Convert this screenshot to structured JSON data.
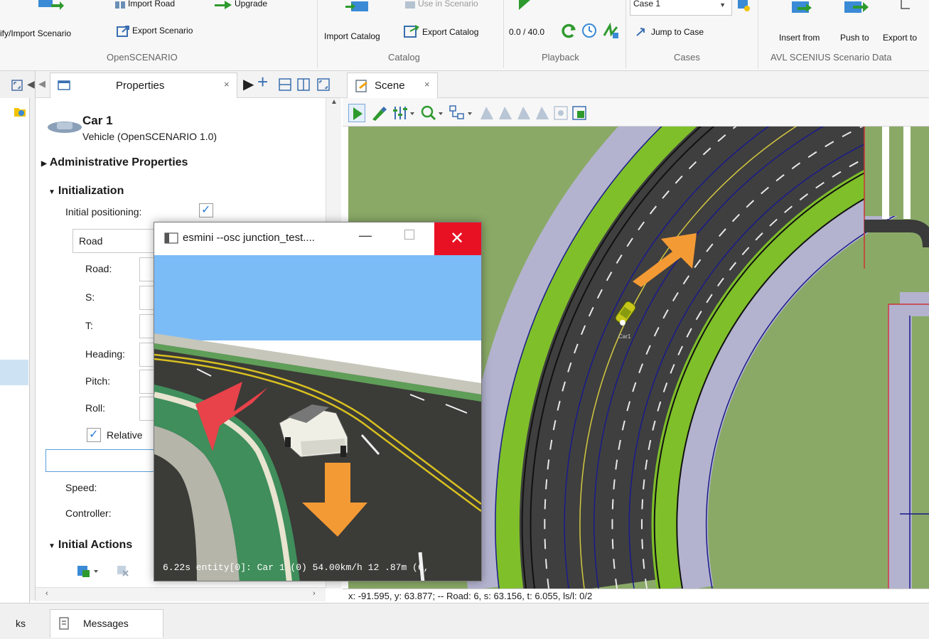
{
  "ribbon": {
    "opensc": {
      "import_road": "Import Road",
      "upgrade": "Upgrade",
      "modify_import": "ify/Import Scenario",
      "export_scenario": "Export Scenario",
      "group": "OpenSCENARIO"
    },
    "catalog": {
      "use_in_scenario": "Use in Scenario",
      "import_catalog": "Import Catalog",
      "export_catalog": "Export Catalog",
      "group": "Catalog"
    },
    "playback": {
      "time": "0.0 / 40.0",
      "group": "Playback"
    },
    "cases": {
      "case_select": "Case 1",
      "jump_to_case": "Jump to Case",
      "group": "Cases"
    },
    "avl": {
      "insert_from": "Insert from",
      "push_to": "Push to",
      "export_to": "Export to",
      "group": "AVL SCENIUS Scenario Data"
    }
  },
  "properties": {
    "tab_title": "Properties",
    "entity_name": "Car 1",
    "entity_type": "Vehicle (OpenSCENARIO 1.0)",
    "admin_section": "Administrative Properties",
    "init_section": "Initialization",
    "initial_positioning": "Initial positioning:",
    "position_type": "Road",
    "fields": [
      "Road:",
      "S:",
      "T:",
      "Heading:",
      "Pitch:",
      "Roll:"
    ],
    "relative": "Relative",
    "speed": "Speed:",
    "controller": "Controller:",
    "initial_actions": "Initial Actions"
  },
  "scene": {
    "tab_title": "Scene",
    "car_label": "Car1",
    "status": "x: -91.595, y: 63.877; -- Road: 6, s: 63.156, t: 6.055, ls/l: 0/2"
  },
  "esmini": {
    "title": "esmini --osc junction_test....",
    "hud": "6.22s entity[0]: Car 1 (0) 54.00km/h 12 .87m (6,"
  },
  "bottom": {
    "tab_partial": "ks",
    "messages": "Messages"
  },
  "colors": {
    "accent_green": "#2e9a2e",
    "close_red": "#e81123",
    "arrow_orange": "#f49a34",
    "arrow_red": "#e8424a"
  }
}
